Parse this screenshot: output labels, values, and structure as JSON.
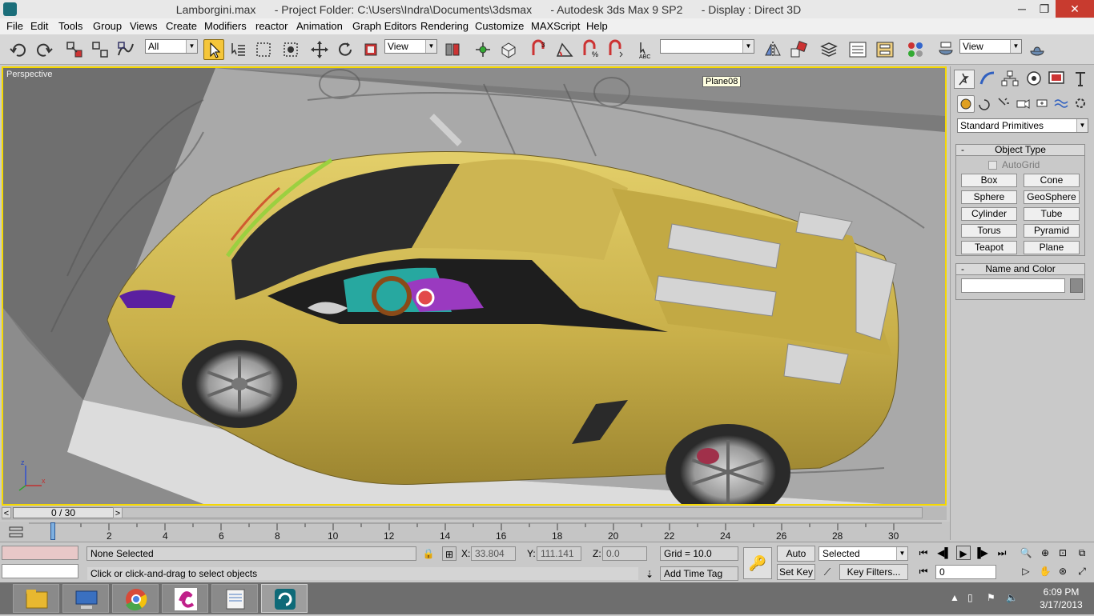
{
  "window": {
    "title": "Lamborgini.max      - Project Folder: C:\\Users\\Indra\\Documents\\3dsmax      - Autodesk 3ds Max 9 SP2      - Display : Direct 3D",
    "min_glyph": "─",
    "max_glyph": "❐",
    "close_glyph": "✕"
  },
  "menu": [
    "File",
    "Edit",
    "Tools",
    "Group",
    "Views",
    "Create",
    "Modifiers",
    "reactor",
    "Animation",
    "Graph Editors",
    "Rendering",
    "Customize",
    "MAXScript",
    "Help"
  ],
  "toolbar": {
    "selection_filter": "All",
    "reference_coord": "View",
    "named_selection": "",
    "viewport_layout": "View",
    "tool_icons": [
      "undo-icon",
      "redo-icon",
      "select-link-icon",
      "unlink-icon",
      "bind-spacewarp-icon",
      "select-object-icon",
      "select-by-name-icon",
      "rect-region-icon",
      "window-crossing-icon",
      "move-icon",
      "rotate-icon",
      "scale-icon",
      "pivot-icon",
      "manipulate-icon",
      "snap-3-icon",
      "angle-snap-icon",
      "percent-snap-icon",
      "spinner-snap-icon",
      "edit-named-sel-icon",
      "mirror-icon",
      "align-icon",
      "layer-icon",
      "curve-editor-icon",
      "schematic-icon",
      "material-editor-icon",
      "render-scene-icon",
      "quick-render-icon"
    ]
  },
  "viewport": {
    "label": "Perspective",
    "tooltip": "Plane08",
    "axis_z": "z",
    "axis_x": "x"
  },
  "command_panel": {
    "tabs": [
      "create-tab-icon",
      "modify-tab-icon",
      "hierarchy-tab-icon",
      "motion-tab-icon",
      "display-tab-icon",
      "utilities-tab-icon"
    ],
    "subtabs": [
      "geometry-icon",
      "shapes-icon",
      "lights-icon",
      "cameras-icon",
      "helpers-icon",
      "spacewarps-icon",
      "systems-icon"
    ],
    "category": "Standard Primitives",
    "object_type": {
      "header": "Object Type",
      "autogrid": "AutoGrid",
      "buttons": [
        "Box",
        "Cone",
        "Sphere",
        "GeoSphere",
        "Cylinder",
        "Tube",
        "Torus",
        "Pyramid",
        "Teapot",
        "Plane"
      ]
    },
    "name_color": {
      "header": "Name and Color",
      "name_value": "",
      "color": "#8a8a8a"
    },
    "minus": "-"
  },
  "timeslider": {
    "label": "0 / 30",
    "frame_ratio": 0,
    "prev": "<",
    "next": ">"
  },
  "trackbar": {
    "ticks": [
      "2",
      "4",
      "6",
      "8",
      "10",
      "12",
      "14",
      "16",
      "18",
      "20",
      "22",
      "24",
      "26",
      "28",
      "30"
    ],
    "max_frame": 30
  },
  "status": {
    "selection": "None Selected",
    "prompt": "Click or click-and-drag to select objects",
    "x_label": "X:",
    "x": "33.804",
    "y_label": "Y:",
    "y": "111.141",
    "z_label": "Z:",
    "z": "0.0",
    "grid": "Grid = 10.0",
    "add_time_tag": "Add Time Tag",
    "auto_key": "Auto Key",
    "set_key": "Set Key",
    "key_mode": "Selected",
    "key_filters": "Key Filters...",
    "current_frame": "0"
  },
  "playback_icons": [
    "go-start-icon",
    "prev-frame-icon",
    "play-icon",
    "next-frame-icon",
    "go-end-icon"
  ],
  "nav_icons": [
    "zoom-icon",
    "zoom-all-icon",
    "zoom-extents-icon",
    "zoom-extents-all-icon",
    "fov-icon",
    "pan-icon",
    "orbit-icon",
    "maximize-toggle-icon"
  ],
  "taskbar": {
    "apps": [
      "file-explorer-icon",
      "remote-desktop-icon",
      "chrome-icon",
      "corel-icon",
      "notepad-icon",
      "3dsmax-icon"
    ],
    "time": "6:09 PM",
    "date": "3/17/2013"
  },
  "colors": {
    "viewport_border": "#f5d800",
    "active_tool": "#f5c63a",
    "car_body": "#c9b04a",
    "selection_swatch": "#e8c8c8"
  }
}
